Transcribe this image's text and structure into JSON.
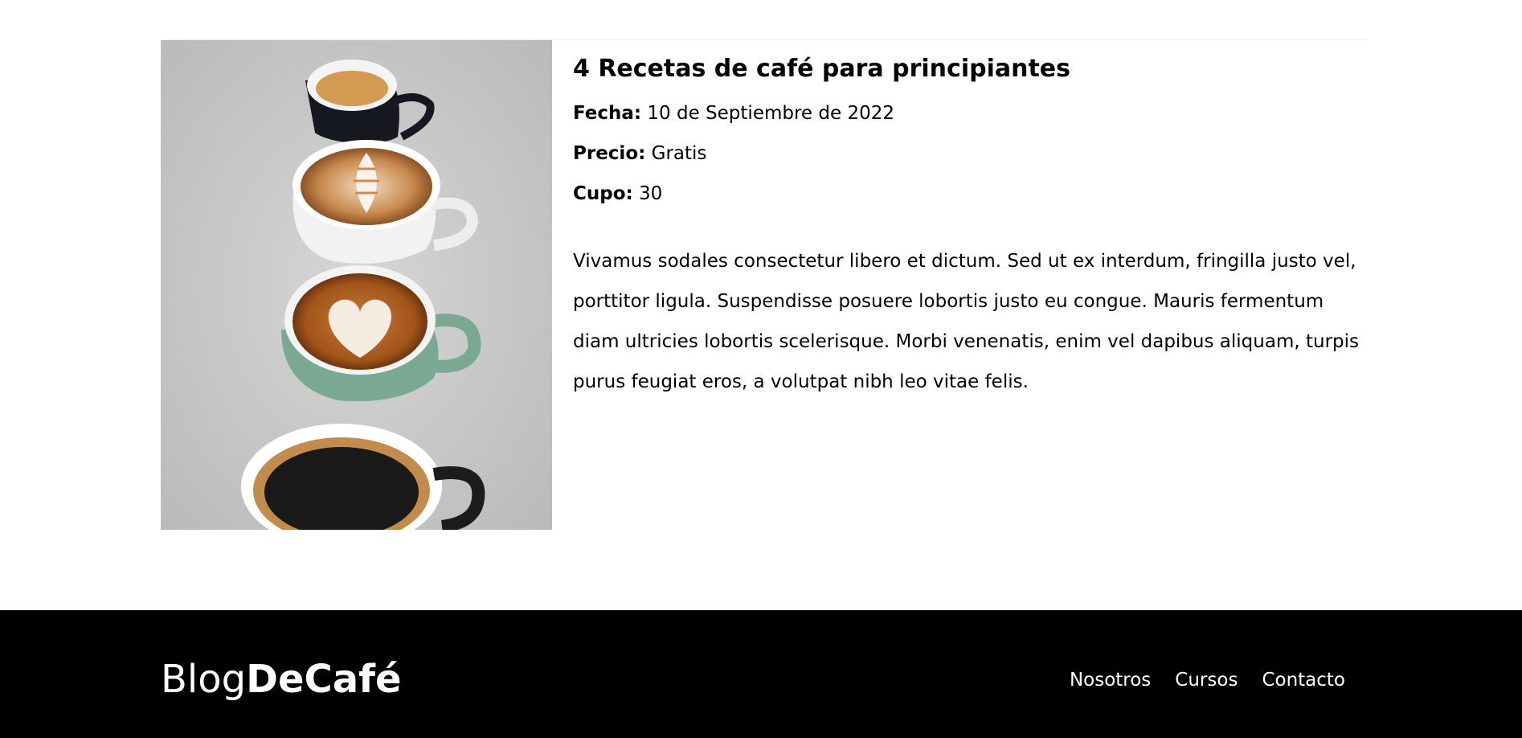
{
  "course": {
    "title": "4 Recetas de café para principiantes",
    "fecha_label": "Fecha:",
    "fecha_value": "10 de Septiembre de 2022",
    "precio_label": "Precio:",
    "precio_value": "Gratis",
    "cupo_label": "Cupo:",
    "cupo_value": "30",
    "description": "Vivamus sodales consectetur libero et dictum. Sed ut ex interdum, fringilla justo vel, porttitor ligula. Suspendisse posuere lobortis justo eu congue. Mauris fermentum diam ultricies lobortis scelerisque. Morbi venenatis, enim vel dapibus aliquam, turpis purus feugiat eros, a volutpat nibh leo vitae felis."
  },
  "footer": {
    "logo_light": "Blog",
    "logo_bold": "DeCafé",
    "nav": [
      "Nosotros",
      "Cursos",
      "Contacto"
    ]
  },
  "colors": {
    "footer_bg": "#000000",
    "image_bg": "#c9c9c9"
  }
}
